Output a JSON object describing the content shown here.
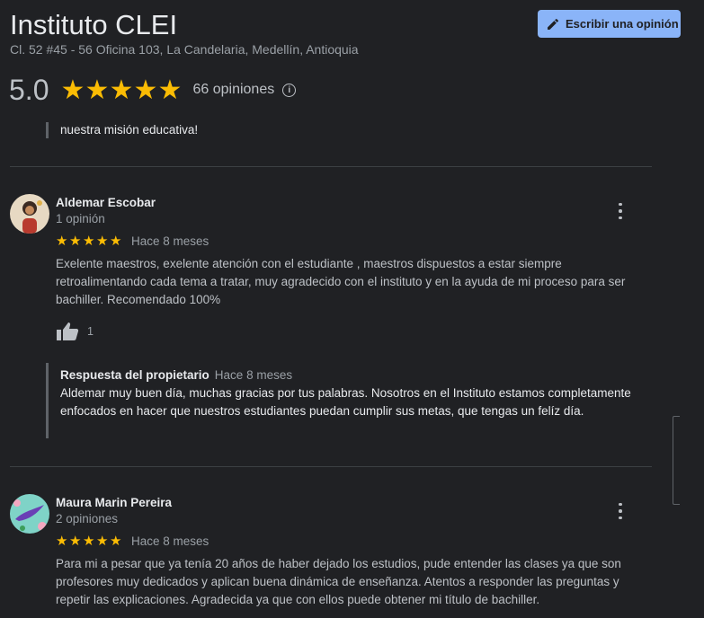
{
  "header": {
    "title": "Instituto CLEI",
    "address": "Cl. 52 #45 - 56 Oficina 103, La Candelaria, Medellín, Antioquia",
    "write_review_label": "Escribir una opinión"
  },
  "rating": {
    "value": "5.0",
    "stars": 5,
    "count_label": "66 opiniones"
  },
  "previous_reply_tail": "nuestra misión educativa!",
  "reviews": [
    {
      "name": "Aldemar Escobar",
      "meta": "1 opinión",
      "stars": 5,
      "date": "Hace 8 meses",
      "text": "Exelente maestros, exelente atención con el estudiante , maestros dispuestos a estar siempre retroalimentando cada tema a tratar, muy agradecido con el instituto y en la ayuda de mi proceso para ser bachiller. Recomendado 100%",
      "likes": "1",
      "owner_reply": {
        "title": "Respuesta del propietario",
        "date": "Hace 8 meses",
        "text": "Aldemar muy buen día, muchas gracias por tus palabras. Nosotros en el Instituto estamos completamente enfocados en hacer que nuestros estudiantes puedan cumplir sus metas, que tengas un felíz día."
      }
    },
    {
      "name": "Maura Marin Pereira",
      "meta": "2 opiniones",
      "stars": 5,
      "date": "Hace 8 meses",
      "text": "Para mi a pesar que ya tenía 20 años de haber dejado los estudios, pude entender las clases ya que son profesores muy dedicados y aplican buena dinámica de enseñanza. Atentos a responder las preguntas y repetir las explicaciones. Agradecida ya que con ellos puede obtener mi título de bachiller."
    }
  ],
  "colors": {
    "background": "#202124",
    "star": "#fbbc04",
    "accent_button": "#8ab4f8"
  }
}
